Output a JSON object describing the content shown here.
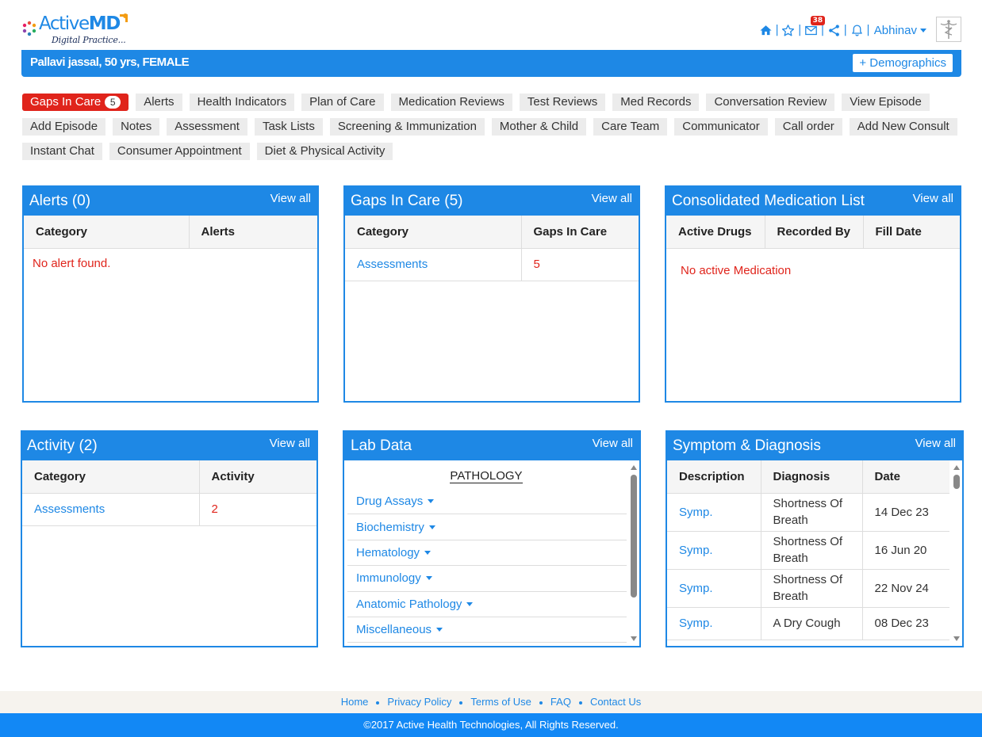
{
  "brand": {
    "name_light": "Active",
    "name_bold": "MD",
    "tagline": "Digital Practice..."
  },
  "topnav": {
    "home_icon": "home-icon",
    "favorite_icon": "star-icon",
    "mail_icon": "mail-icon",
    "mail_badge": "38",
    "share_icon": "share-icon",
    "bell_icon": "bell-icon",
    "user_name": "Abhinav"
  },
  "patient": {
    "summary": "Pallavi jassal, 50 yrs, FEMALE",
    "demographics_label": "+ Demographics"
  },
  "tabs": [
    {
      "label": "Gaps In Care",
      "count": "5",
      "active": true
    },
    {
      "label": "Alerts"
    },
    {
      "label": "Health Indicators"
    },
    {
      "label": "Plan of Care"
    },
    {
      "label": "Medication Reviews"
    },
    {
      "label": "Test Reviews"
    },
    {
      "label": "Med Records"
    },
    {
      "label": "Conversation Review"
    },
    {
      "label": "View Episode"
    },
    {
      "label": "Add Episode"
    },
    {
      "label": "Notes"
    },
    {
      "label": "Assessment"
    },
    {
      "label": "Task Lists"
    },
    {
      "label": "Screening & Immunization"
    },
    {
      "label": "Mother & Child"
    },
    {
      "label": "Care Team"
    },
    {
      "label": "Communicator"
    },
    {
      "label": "Call order"
    },
    {
      "label": "Add New Consult"
    },
    {
      "label": "Instant Chat"
    },
    {
      "label": "Consumer Appointment"
    },
    {
      "label": "Diet & Physical Activity"
    }
  ],
  "panels": {
    "view_all": "View all",
    "alerts": {
      "title": "Alerts (0)",
      "columns": [
        "Category",
        "Alerts"
      ],
      "empty": "No alert found."
    },
    "gaps": {
      "title": "Gaps In Care (5)",
      "columns": [
        "Category",
        "Gaps In Care"
      ],
      "rows": [
        {
          "category": "Assessments",
          "value": "5"
        }
      ]
    },
    "medication": {
      "title": "Consolidated Medication List",
      "columns": [
        "Active Drugs",
        "Recorded By",
        "Fill Date"
      ],
      "empty": "No active Medication"
    },
    "activity": {
      "title": "Activity (2)",
      "columns": [
        "Category",
        "Activity"
      ],
      "rows": [
        {
          "category": "Assessments",
          "value": "2"
        }
      ]
    },
    "lab": {
      "title": "Lab Data",
      "heading": "PATHOLOGY",
      "items": [
        "Drug Assays",
        "Biochemistry",
        "Hematology",
        "Immunology",
        "Anatomic Pathology",
        "Miscellaneous"
      ]
    },
    "symptom": {
      "title": "Symptom & Diagnosis",
      "columns": [
        "Description",
        "Diagnosis",
        "Date"
      ],
      "rows": [
        {
          "description": "Symp.",
          "diagnosis": "Shortness Of Breath",
          "date": "14 Dec 23"
        },
        {
          "description": "Symp.",
          "diagnosis": "Shortness Of Breath",
          "date": "16 Jun 20"
        },
        {
          "description": "Symp.",
          "diagnosis": "Shortness Of Breath",
          "date": "22 Nov 24"
        },
        {
          "description": "Symp.",
          "diagnosis": "A Dry Cough",
          "date": "08 Dec 23"
        }
      ]
    }
  },
  "footer": {
    "links": [
      "Home",
      "Privacy Policy",
      "Terms of Use",
      "FAQ",
      "Contact Us"
    ],
    "copyright": "©2017 Active Health Technologies, All Rights Reserved."
  },
  "colors": {
    "primary": "#1e88e5",
    "alert_red": "#e0241b",
    "tab_bg": "#ececec",
    "footer_bar": "#1288f5",
    "footer_links_bg": "#f6f3ee"
  }
}
